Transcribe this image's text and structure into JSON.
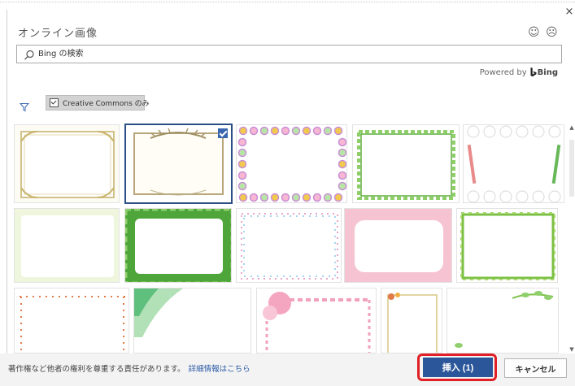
{
  "dialog": {
    "title": "オンライン画像",
    "close_glyph": "×",
    "feedback": [
      {
        "glyph": "☺",
        "icon": "smiley-face-icon"
      },
      {
        "glyph": "☹",
        "icon": "frowning-face-icon"
      }
    ]
  },
  "search": {
    "placeholder": "Bing の検索",
    "value": "",
    "icon": "search-icon"
  },
  "powered_by": {
    "text": "Powered by",
    "brand": "Bing"
  },
  "filter": {
    "icon": "filter-icon",
    "license_chip": {
      "label": "Creative Commons のみ",
      "checked": true
    }
  },
  "results": {
    "selected_count": 1,
    "thumbnails": [
      {
        "id": "thumb-1",
        "style": "gold-ornate",
        "selected": false
      },
      {
        "id": "thumb-2",
        "style": "laurel-sepia",
        "selected": true
      },
      {
        "id": "thumb-3",
        "style": "dots-pastel",
        "selected": false
      },
      {
        "id": "thumb-4",
        "style": "leaf-vine",
        "selected": false
      },
      {
        "id": "thumb-5",
        "style": "toothbrush",
        "selected": false
      },
      {
        "id": "thumb-6",
        "style": "soft-green",
        "selected": false
      },
      {
        "id": "thumb-7",
        "style": "leaf-thick",
        "selected": false
      },
      {
        "id": "thumb-8",
        "style": "musical-notes",
        "selected": false
      },
      {
        "id": "thumb-9",
        "style": "sakura-pink",
        "selected": false
      },
      {
        "id": "thumb-10",
        "style": "ivy",
        "selected": false
      },
      {
        "id": "thumb-11",
        "style": "red-dots",
        "selected": false
      },
      {
        "id": "thumb-12",
        "style": "leaf-corner",
        "selected": false
      },
      {
        "id": "thumb-13",
        "style": "pink-flowers",
        "selected": false
      },
      {
        "id": "thumb-14",
        "style": "thin-gold",
        "selected": false
      },
      {
        "id": "thumb-15",
        "style": "corner-branch",
        "selected": false
      }
    ]
  },
  "footer": {
    "notice": "著作権など他者の権利を尊重する責任があります。",
    "link_text": "詳細情報はこちら",
    "insert_label": "挿入 (1)",
    "cancel_label": "キャンセル"
  },
  "colors": {
    "primary_button": "#2b579a",
    "highlight_outline": "#e01f26",
    "selected_border": "#2b4e86",
    "link": "#2a5aa6"
  }
}
